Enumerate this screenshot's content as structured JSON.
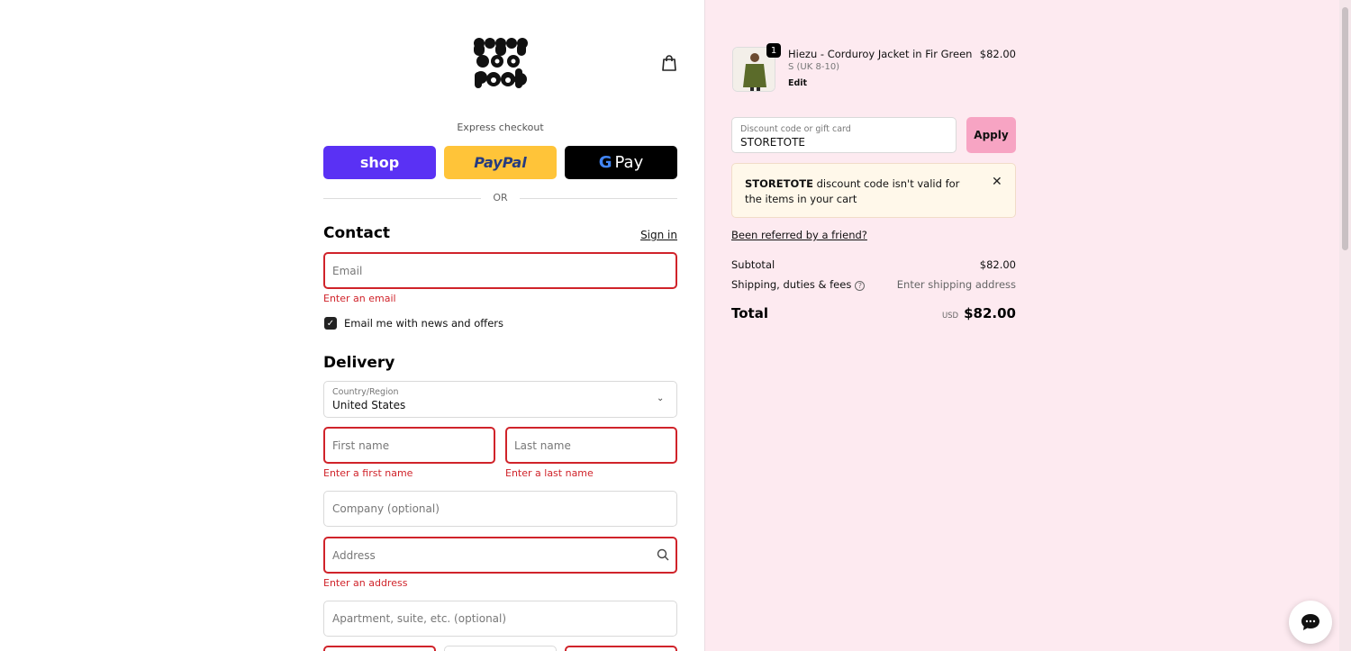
{
  "brand": {
    "logo_text": "Lucy & Yak"
  },
  "express": {
    "label": "Express checkout",
    "shop_label": "shop",
    "paypal_label": "PayPal",
    "gpay_g": "G",
    "gpay_label": "Pay",
    "or_label": "OR"
  },
  "contact": {
    "heading": "Contact",
    "signin_label": "Sign in",
    "email_placeholder": "Email",
    "email_error": "Enter an email",
    "news_label": "Email me with news and offers",
    "news_checked": true
  },
  "delivery": {
    "heading": "Delivery",
    "country_label": "Country/Region",
    "country_value": "United States",
    "first_name_placeholder": "First name",
    "first_name_error": "Enter a first name",
    "last_name_placeholder": "Last name",
    "last_name_error": "Enter a last name",
    "company_placeholder": "Company (optional)",
    "address_placeholder": "Address",
    "address_error": "Enter an address",
    "apartment_placeholder": "Apartment, suite, etc. (optional)"
  },
  "cart": {
    "item": {
      "quantity": "1",
      "title": "Hiezu - Corduroy Jacket in Fir Green",
      "variant": "S (UK 8-10)",
      "edit_label": "Edit",
      "price": "$82.00"
    },
    "discount": {
      "label": "Discount code or gift card",
      "value": "STORETOTE",
      "apply_label": "Apply"
    },
    "alert": {
      "code": "STORETOTE",
      "message": " discount code isn't valid for the items in your cart",
      "close_symbol": "✕"
    },
    "referred_label": "Been referred by a friend?",
    "subtotal_label": "Subtotal",
    "subtotal_value": "$82.00",
    "shipping_label": "Shipping, duties & fees",
    "shipping_value": "Enter shipping address",
    "total_label": "Total",
    "total_currency": "USD",
    "total_value": "$82.00"
  },
  "colors": {
    "shop": "#5a31f4",
    "paypal": "#ffc439",
    "gpay": "#000000",
    "error": "#d0232a",
    "apply": "#f7a4c3",
    "sidebar_bg": "#fdeaf0"
  }
}
